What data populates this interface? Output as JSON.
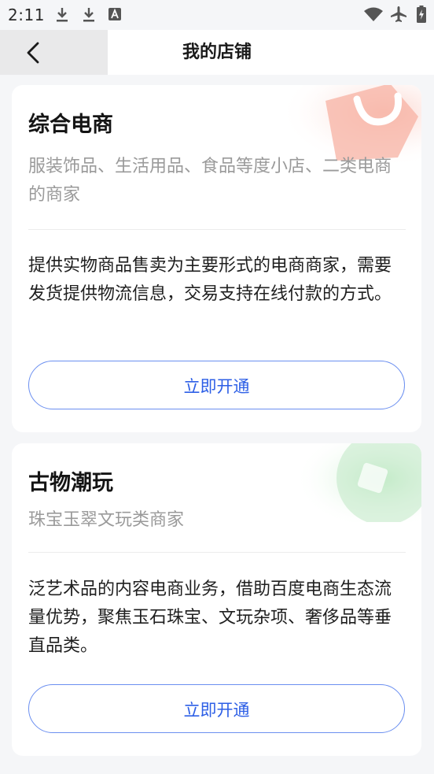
{
  "status_bar": {
    "time": "2:11",
    "icons": [
      "download-icon",
      "download-icon",
      "a-badge-icon",
      "wifi-icon",
      "airplane-mode-icon",
      "battery-charging-icon"
    ]
  },
  "nav": {
    "title": "我的店铺",
    "back_icon": "chevron-left-icon"
  },
  "cards": [
    {
      "title": "综合电商",
      "subtitle": "服装饰品、生活用品、食品等度小店、二类电商的商家",
      "description": "提供实物商品售卖为主要形式的电商商家，需要发货提供物流信息，交易支持在线付款的方式。",
      "button_label": "立即开通",
      "accent": "#f6a89a"
    },
    {
      "title": "古物潮玩",
      "subtitle": "珠宝玉翠文玩类商家",
      "description": "泛艺术品的内容电商业务，借助百度电商生态流量优势，聚焦玉石珠宝、文玩杂项、奢侈品等垂直品类。",
      "button_label": "立即开通",
      "accent": "#9fe0a6"
    }
  ],
  "colors": {
    "page_bg": "#f5f6f8",
    "button_text": "#2d5fe6",
    "button_border": "#6b8ff0",
    "subtitle_text": "#9a9a9a"
  }
}
